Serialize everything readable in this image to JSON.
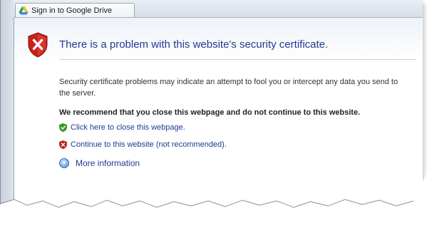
{
  "tab": {
    "title": "Sign in to Google Drive",
    "icon": "google-drive-icon"
  },
  "page": {
    "title": "There is a problem with this website's security certificate.",
    "description": "Security certificate problems may indicate an attempt to fool you or intercept any data you send to the server.",
    "recommendation": "We recommend that you close this webpage and do not continue to this website.",
    "close_link": "Click here to close this webpage.",
    "continue_link": "Continue to this website (not recommended).",
    "more_info": "More information",
    "shield_icon": "error-shield-icon",
    "colors": {
      "title": "#1f3a93",
      "link": "#1f3a93",
      "shield_red": "#c8211b",
      "shield_green": "#3a9a2a"
    }
  }
}
